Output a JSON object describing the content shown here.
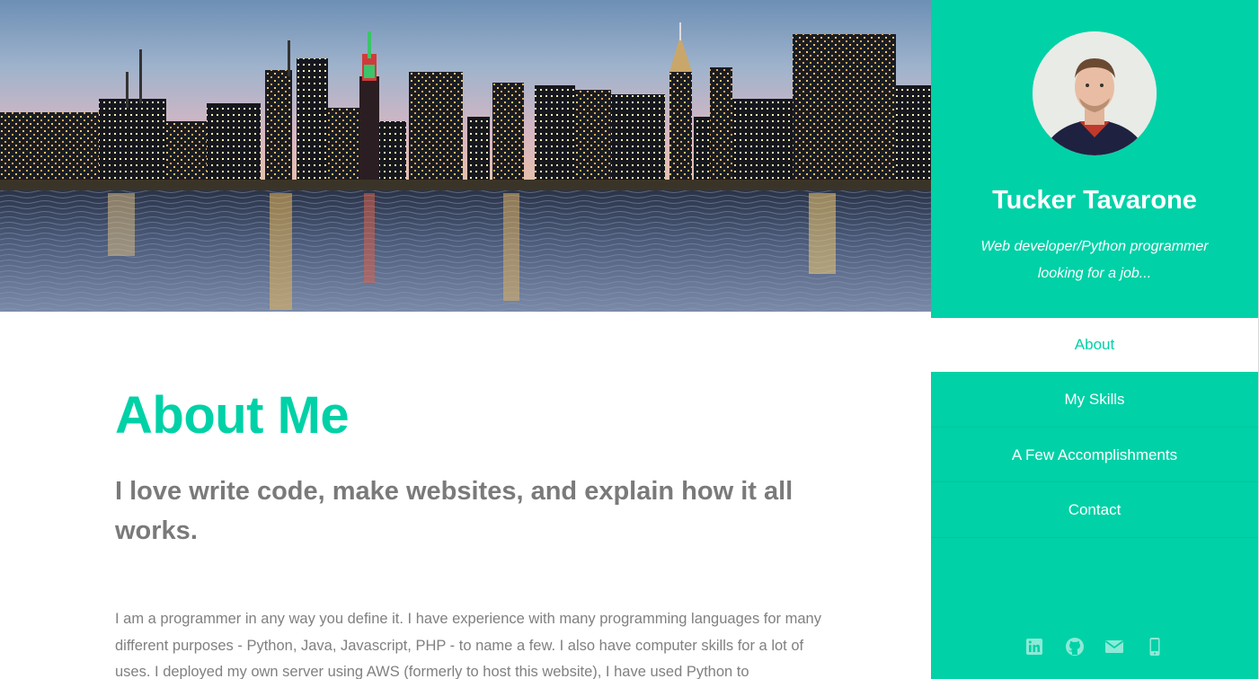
{
  "hero": {
    "image_description": "city-skyline-at-dusk-over-river",
    "icon": "skyline-photo"
  },
  "main": {
    "title": "About Me",
    "subheading": "I love write code, make websites, and explain how it all works.",
    "body": "I am a programmer in any way you define it. I have experience with many programming languages for many different purposes - Python, Java, Javascript, PHP - to name a few. I also have computer skills for a lot of uses. I deployed my own server using AWS (formerly to host this website), I have used Python to"
  },
  "sidebar": {
    "name": "Tucker Tavarone",
    "tagline": "Web developer/Python programmer looking for a job...",
    "nav": [
      {
        "label": "About",
        "active": true
      },
      {
        "label": "My Skills",
        "active": false
      },
      {
        "label": "A Few Accomplishments",
        "active": false
      },
      {
        "label": "Contact",
        "active": false
      }
    ],
    "social_icons": [
      "linkedin-icon",
      "github-icon",
      "email-icon",
      "phone-icon"
    ]
  },
  "colors": {
    "accent": "#00d1a7",
    "text_gray": "#808080",
    "heading_gray": "#7a7a7a"
  }
}
